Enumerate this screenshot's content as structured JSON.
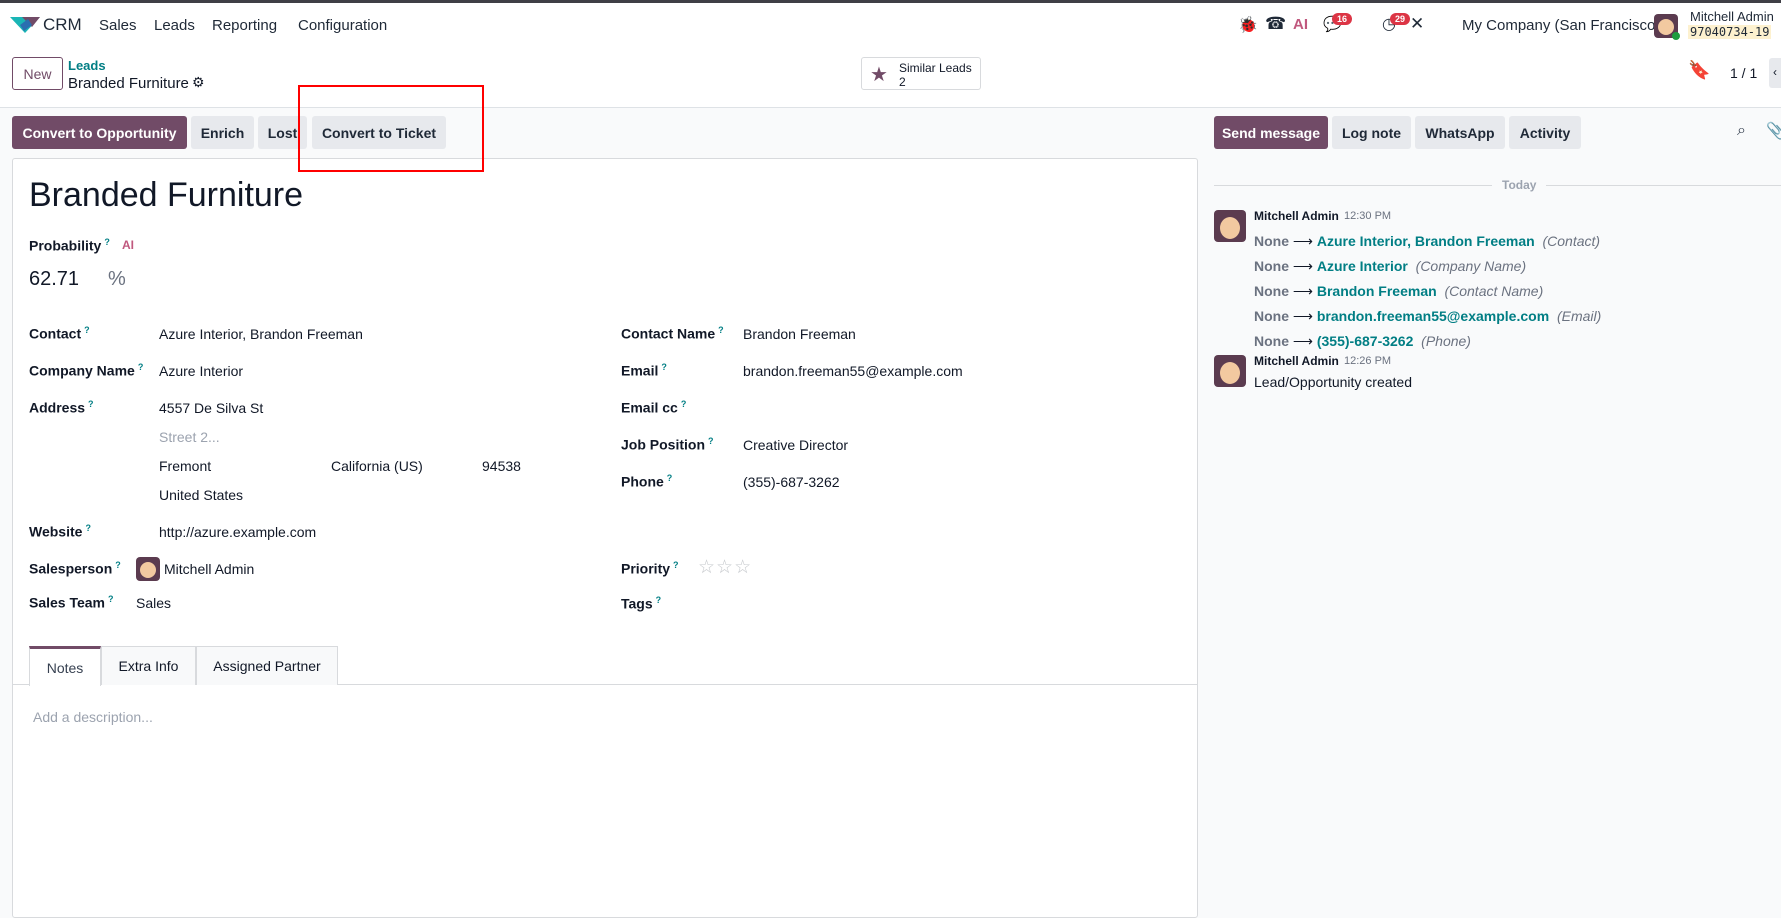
{
  "navbar": {
    "app": "CRM",
    "menu": [
      "Sales",
      "Leads",
      "Reporting",
      "Configuration"
    ],
    "chat_badge": "16",
    "activity_badge": "29",
    "company": "My Company (San Francisco)",
    "user": "Mitchell Admin",
    "db": "97040734-19"
  },
  "control": {
    "new_label": "New",
    "breadcrumb_parent": "Leads",
    "breadcrumb_current": "Branded Furniture",
    "similar_label": "Similar Leads",
    "similar_count": "2",
    "pager": "1 / 1"
  },
  "actions": {
    "convert_opportunity": "Convert to Opportunity",
    "enrich": "Enrich",
    "lost": "Lost",
    "convert_ticket": "Convert to Ticket"
  },
  "form": {
    "title": "Branded Furniture",
    "probability_label": "Probability",
    "ai": "AI",
    "probability": "62.71",
    "percent": "%",
    "left": {
      "contact_label": "Contact",
      "contact": "Azure Interior, Brandon Freeman",
      "company_label": "Company Name",
      "company": "Azure Interior",
      "address_label": "Address",
      "street": "4557 De Silva St",
      "street2_placeholder": "Street 2...",
      "city": "Fremont",
      "state": "California (US)",
      "zip": "94538",
      "country": "United States",
      "website_label": "Website",
      "website": "http://azure.example.com",
      "salesperson_label": "Salesperson",
      "salesperson": "Mitchell Admin",
      "team_label": "Sales Team",
      "team": "Sales"
    },
    "right": {
      "contact_name_label": "Contact Name",
      "contact_name": "Brandon Freeman",
      "email_label": "Email",
      "email": "brandon.freeman55@example.com",
      "email_cc_label": "Email cc",
      "job_label": "Job Position",
      "job": "Creative Director",
      "phone_label": "Phone",
      "phone": "(355)-687-3262",
      "priority_label": "Priority",
      "priority_value": 0,
      "tags_label": "Tags"
    },
    "tabs": [
      "Notes",
      "Extra Info",
      "Assigned Partner"
    ],
    "description_placeholder": "Add a description..."
  },
  "chatter": {
    "buttons": [
      "Send message",
      "Log note",
      "WhatsApp",
      "Activity"
    ],
    "date_sep": "Today",
    "messages": [
      {
        "author": "Mitchell Admin",
        "time": "12:30 PM",
        "changes": [
          {
            "old": "None",
            "new": "Azure Interior, Brandon Freeman",
            "field": "(Contact)"
          },
          {
            "old": "None",
            "new": "Azure Interior",
            "field": "(Company Name)"
          },
          {
            "old": "None",
            "new": "Brandon Freeman",
            "field": "(Contact Name)"
          },
          {
            "old": "None",
            "new": "brandon.freeman55@example.com",
            "field": "(Email)"
          },
          {
            "old": "None",
            "new": "(355)-687-3262",
            "field": "(Phone)"
          }
        ]
      },
      {
        "author": "Mitchell Admin",
        "time": "12:26 PM",
        "body": "Lead/Opportunity created"
      }
    ]
  },
  "colors": {
    "primary": "#714b67",
    "link": "#017e84",
    "highlight": "#ff0000"
  }
}
